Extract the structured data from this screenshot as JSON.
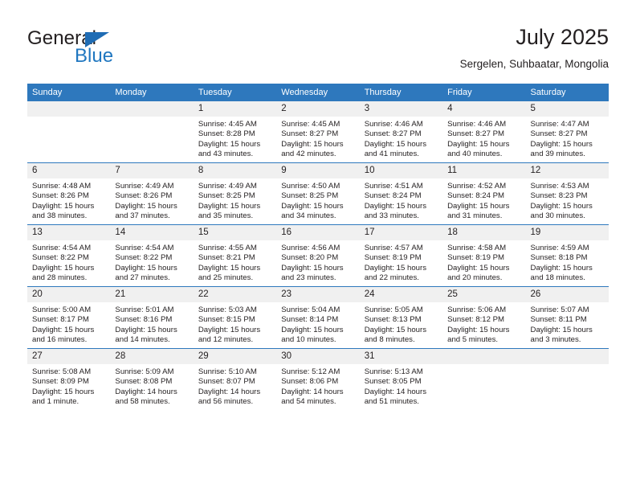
{
  "brand": {
    "name_top": "General",
    "name_bottom": "Blue",
    "triangle_icon": "triangle-icon",
    "color_blue": "#2077c0",
    "color_dark": "#231f20"
  },
  "header": {
    "title": "July 2025",
    "subtitle": "Sergelen, Suhbaatar, Mongolia"
  },
  "theme": {
    "header_bg": "#2e78bd",
    "daynum_bg": "#f0f0f0",
    "cell_bg": "#ffffff",
    "text": "#231f20"
  },
  "weekdays": [
    "Sunday",
    "Monday",
    "Tuesday",
    "Wednesday",
    "Thursday",
    "Friday",
    "Saturday"
  ],
  "weeks": [
    [
      {
        "day": "",
        "sunrise": "",
        "sunset": "",
        "daylight1": "",
        "daylight2": ""
      },
      {
        "day": "",
        "sunrise": "",
        "sunset": "",
        "daylight1": "",
        "daylight2": ""
      },
      {
        "day": "1",
        "sunrise": "Sunrise: 4:45 AM",
        "sunset": "Sunset: 8:28 PM",
        "daylight1": "Daylight: 15 hours",
        "daylight2": "and 43 minutes."
      },
      {
        "day": "2",
        "sunrise": "Sunrise: 4:45 AM",
        "sunset": "Sunset: 8:27 PM",
        "daylight1": "Daylight: 15 hours",
        "daylight2": "and 42 minutes."
      },
      {
        "day": "3",
        "sunrise": "Sunrise: 4:46 AM",
        "sunset": "Sunset: 8:27 PM",
        "daylight1": "Daylight: 15 hours",
        "daylight2": "and 41 minutes."
      },
      {
        "day": "4",
        "sunrise": "Sunrise: 4:46 AM",
        "sunset": "Sunset: 8:27 PM",
        "daylight1": "Daylight: 15 hours",
        "daylight2": "and 40 minutes."
      },
      {
        "day": "5",
        "sunrise": "Sunrise: 4:47 AM",
        "sunset": "Sunset: 8:27 PM",
        "daylight1": "Daylight: 15 hours",
        "daylight2": "and 39 minutes."
      }
    ],
    [
      {
        "day": "6",
        "sunrise": "Sunrise: 4:48 AM",
        "sunset": "Sunset: 8:26 PM",
        "daylight1": "Daylight: 15 hours",
        "daylight2": "and 38 minutes."
      },
      {
        "day": "7",
        "sunrise": "Sunrise: 4:49 AM",
        "sunset": "Sunset: 8:26 PM",
        "daylight1": "Daylight: 15 hours",
        "daylight2": "and 37 minutes."
      },
      {
        "day": "8",
        "sunrise": "Sunrise: 4:49 AM",
        "sunset": "Sunset: 8:25 PM",
        "daylight1": "Daylight: 15 hours",
        "daylight2": "and 35 minutes."
      },
      {
        "day": "9",
        "sunrise": "Sunrise: 4:50 AM",
        "sunset": "Sunset: 8:25 PM",
        "daylight1": "Daylight: 15 hours",
        "daylight2": "and 34 minutes."
      },
      {
        "day": "10",
        "sunrise": "Sunrise: 4:51 AM",
        "sunset": "Sunset: 8:24 PM",
        "daylight1": "Daylight: 15 hours",
        "daylight2": "and 33 minutes."
      },
      {
        "day": "11",
        "sunrise": "Sunrise: 4:52 AM",
        "sunset": "Sunset: 8:24 PM",
        "daylight1": "Daylight: 15 hours",
        "daylight2": "and 31 minutes."
      },
      {
        "day": "12",
        "sunrise": "Sunrise: 4:53 AM",
        "sunset": "Sunset: 8:23 PM",
        "daylight1": "Daylight: 15 hours",
        "daylight2": "and 30 minutes."
      }
    ],
    [
      {
        "day": "13",
        "sunrise": "Sunrise: 4:54 AM",
        "sunset": "Sunset: 8:22 PM",
        "daylight1": "Daylight: 15 hours",
        "daylight2": "and 28 minutes."
      },
      {
        "day": "14",
        "sunrise": "Sunrise: 4:54 AM",
        "sunset": "Sunset: 8:22 PM",
        "daylight1": "Daylight: 15 hours",
        "daylight2": "and 27 minutes."
      },
      {
        "day": "15",
        "sunrise": "Sunrise: 4:55 AM",
        "sunset": "Sunset: 8:21 PM",
        "daylight1": "Daylight: 15 hours",
        "daylight2": "and 25 minutes."
      },
      {
        "day": "16",
        "sunrise": "Sunrise: 4:56 AM",
        "sunset": "Sunset: 8:20 PM",
        "daylight1": "Daylight: 15 hours",
        "daylight2": "and 23 minutes."
      },
      {
        "day": "17",
        "sunrise": "Sunrise: 4:57 AM",
        "sunset": "Sunset: 8:19 PM",
        "daylight1": "Daylight: 15 hours",
        "daylight2": "and 22 minutes."
      },
      {
        "day": "18",
        "sunrise": "Sunrise: 4:58 AM",
        "sunset": "Sunset: 8:19 PM",
        "daylight1": "Daylight: 15 hours",
        "daylight2": "and 20 minutes."
      },
      {
        "day": "19",
        "sunrise": "Sunrise: 4:59 AM",
        "sunset": "Sunset: 8:18 PM",
        "daylight1": "Daylight: 15 hours",
        "daylight2": "and 18 minutes."
      }
    ],
    [
      {
        "day": "20",
        "sunrise": "Sunrise: 5:00 AM",
        "sunset": "Sunset: 8:17 PM",
        "daylight1": "Daylight: 15 hours",
        "daylight2": "and 16 minutes."
      },
      {
        "day": "21",
        "sunrise": "Sunrise: 5:01 AM",
        "sunset": "Sunset: 8:16 PM",
        "daylight1": "Daylight: 15 hours",
        "daylight2": "and 14 minutes."
      },
      {
        "day": "22",
        "sunrise": "Sunrise: 5:03 AM",
        "sunset": "Sunset: 8:15 PM",
        "daylight1": "Daylight: 15 hours",
        "daylight2": "and 12 minutes."
      },
      {
        "day": "23",
        "sunrise": "Sunrise: 5:04 AM",
        "sunset": "Sunset: 8:14 PM",
        "daylight1": "Daylight: 15 hours",
        "daylight2": "and 10 minutes."
      },
      {
        "day": "24",
        "sunrise": "Sunrise: 5:05 AM",
        "sunset": "Sunset: 8:13 PM",
        "daylight1": "Daylight: 15 hours",
        "daylight2": "and 8 minutes."
      },
      {
        "day": "25",
        "sunrise": "Sunrise: 5:06 AM",
        "sunset": "Sunset: 8:12 PM",
        "daylight1": "Daylight: 15 hours",
        "daylight2": "and 5 minutes."
      },
      {
        "day": "26",
        "sunrise": "Sunrise: 5:07 AM",
        "sunset": "Sunset: 8:11 PM",
        "daylight1": "Daylight: 15 hours",
        "daylight2": "and 3 minutes."
      }
    ],
    [
      {
        "day": "27",
        "sunrise": "Sunrise: 5:08 AM",
        "sunset": "Sunset: 8:09 PM",
        "daylight1": "Daylight: 15 hours",
        "daylight2": "and 1 minute."
      },
      {
        "day": "28",
        "sunrise": "Sunrise: 5:09 AM",
        "sunset": "Sunset: 8:08 PM",
        "daylight1": "Daylight: 14 hours",
        "daylight2": "and 58 minutes."
      },
      {
        "day": "29",
        "sunrise": "Sunrise: 5:10 AM",
        "sunset": "Sunset: 8:07 PM",
        "daylight1": "Daylight: 14 hours",
        "daylight2": "and 56 minutes."
      },
      {
        "day": "30",
        "sunrise": "Sunrise: 5:12 AM",
        "sunset": "Sunset: 8:06 PM",
        "daylight1": "Daylight: 14 hours",
        "daylight2": "and 54 minutes."
      },
      {
        "day": "31",
        "sunrise": "Sunrise: 5:13 AM",
        "sunset": "Sunset: 8:05 PM",
        "daylight1": "Daylight: 14 hours",
        "daylight2": "and 51 minutes."
      },
      {
        "day": "",
        "sunrise": "",
        "sunset": "",
        "daylight1": "",
        "daylight2": ""
      },
      {
        "day": "",
        "sunrise": "",
        "sunset": "",
        "daylight1": "",
        "daylight2": ""
      }
    ]
  ]
}
